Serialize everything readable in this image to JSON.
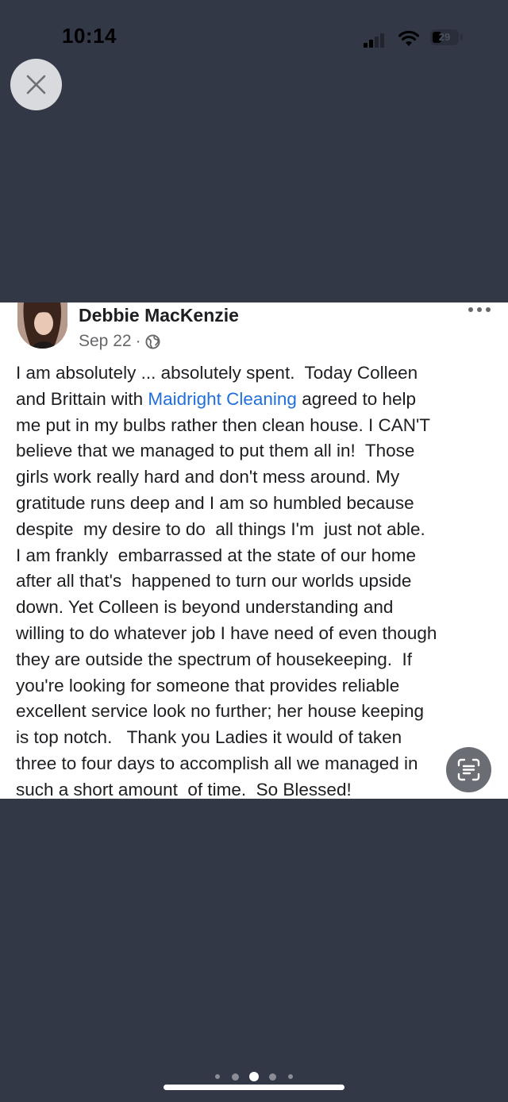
{
  "status_bar": {
    "time": "10:14",
    "battery_level": "29"
  },
  "viewer": {
    "close_icon": "close-icon",
    "page_count": 5,
    "current_page": 3
  },
  "post": {
    "author": "Debbie MacKenzie",
    "date": "Sep 22",
    "separator": "·",
    "privacy_icon": "globe-icon",
    "more_icon": "more-options-icon",
    "lines": [
      "I am absolutely ... absolutely spent.  Today Colleen",
      "and Brittain with ",
      "Maidright Cleaning",
      " agreed to help",
      "me put in my bulbs rather then clean house. I CAN'T",
      "believe that we managed to put them all in!  Those",
      "girls work really hard and don't mess around. My",
      "gratitude runs deep and I am so humbled because",
      "despite  my desire to do  all things I'm  just not able.",
      "I am frankly  embarrassed at the state of our home",
      "after all that's  happened to turn our worlds upside",
      "down. Yet Colleen is beyond understanding and",
      "willing to do whatever job I have need of even though",
      "they are outside the spectrum of housekeeping.  If",
      "you're looking for someone that provides reliable",
      "excellent service look no further; her house keeping",
      "is top notch.   Thank you Ladies it would of taken",
      "three to four days to accomplish all we managed in",
      "such a short amount  of time.  So Blessed!"
    ]
  },
  "colors": {
    "background": "#333846",
    "card": "#ffffff",
    "link": "#216fdb",
    "text": "#1c1e21",
    "meta": "#65676b"
  },
  "live_text_icon": "text-scan-icon"
}
